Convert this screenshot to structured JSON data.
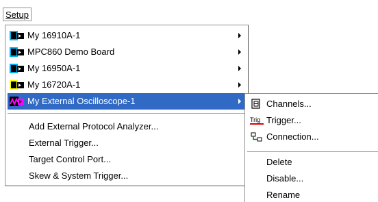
{
  "menubar": {
    "setup_label": "Setup"
  },
  "menu": {
    "items": [
      {
        "label": "My 16910A-1",
        "icon": "logic-analyzer-cyan-icon",
        "has_submenu": true
      },
      {
        "label": "MPC860 Demo Board",
        "icon": "logic-analyzer-cyan-icon",
        "has_submenu": true
      },
      {
        "label": "My 16950A-1",
        "icon": "logic-analyzer-cyan-icon",
        "has_submenu": true
      },
      {
        "label": "My 16720A-1",
        "icon": "pattern-generator-yellow-icon",
        "has_submenu": true
      },
      {
        "label": "My External Oscilloscope-1",
        "icon": "oscilloscope-magenta-icon",
        "has_submenu": true,
        "selected": true
      },
      {
        "label": "Add External Protocol Analyzer..."
      },
      {
        "label": "External Trigger..."
      },
      {
        "label": "Target Control Port..."
      },
      {
        "label": "Skew & System Trigger..."
      }
    ]
  },
  "submenu": {
    "items": [
      {
        "label": "Channels...",
        "icon": "channels-icon"
      },
      {
        "label": "Trigger...",
        "icon": "trigger-icon"
      },
      {
        "label": "Connection...",
        "icon": "connection-icon"
      },
      {
        "label": "Delete"
      },
      {
        "label": "Disable..."
      },
      {
        "label": "Rename"
      }
    ]
  },
  "colors": {
    "selection": "#316ac5",
    "icon_cyan": "#00b0f0",
    "icon_yellow": "#ffff00",
    "icon_magenta": "#ff00ff"
  }
}
